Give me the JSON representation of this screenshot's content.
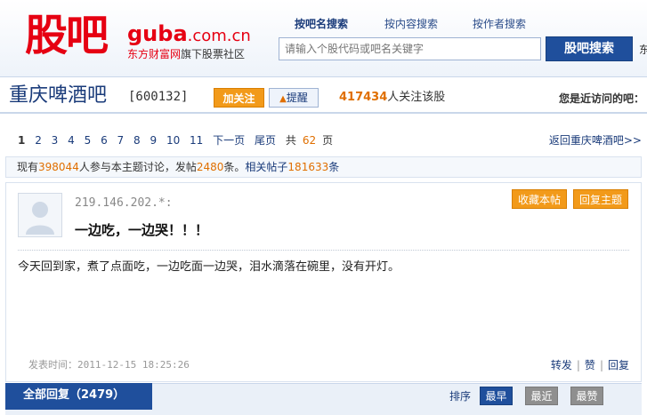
{
  "header": {
    "logo_cn": "股吧",
    "logo_en_main": "guba",
    "logo_en_domain": ".com.cn",
    "logo_sub_brand": "东方财富网",
    "logo_sub_text": "旗下股票社区",
    "tabs": [
      {
        "label": "按吧名搜索",
        "active": true
      },
      {
        "label": "按内容搜索",
        "active": false
      },
      {
        "label": "按作者搜索",
        "active": false
      }
    ],
    "search_placeholder": "请输入个股代码或吧名关键字",
    "search_button": "股吧搜索",
    "edge_text": "东"
  },
  "bar": {
    "name": "重庆啤酒吧",
    "code": "[600132]",
    "follow_button": "加关注",
    "remind_button": "提醒",
    "follower_count": "417434",
    "follower_suffix": "人关注该股",
    "recent_label": "您是近访问的吧："
  },
  "pager": {
    "pages": [
      "1",
      "2",
      "3",
      "4",
      "5",
      "6",
      "7",
      "8",
      "9",
      "10",
      "11"
    ],
    "current": "1",
    "next": "下一页",
    "last": "尾页",
    "total_prefix": "共",
    "total_pages": "62",
    "total_suffix": "页",
    "back_link": "返回重庆啤酒吧>>"
  },
  "stats": {
    "prefix": "现有",
    "participants": "398044",
    "participants_suffix": "人参与本主题讨论，发帖",
    "posts": "2480",
    "posts_suffix": "条。",
    "related_prefix": "相关帖子",
    "related": "181633",
    "related_suffix": "条"
  },
  "post": {
    "author": "219.146.202.*:",
    "title": "一边吃，一边哭！！！",
    "fav_button": "收藏本帖",
    "reply_topic_button": "回复主题",
    "body": "今天回到家，煮了点面吃，一边吃面一边哭，泪水滴落在碗里，没有开灯。",
    "time_label": "发表时间：",
    "time_value": "2011-12-15 18:25:26",
    "actions": [
      "转发",
      "赞",
      "回复"
    ]
  },
  "footer": {
    "all_replies": "全部回复（2479）",
    "sort_label": "排序",
    "sort_buttons": [
      "最早",
      "最近",
      "最赞"
    ]
  },
  "colors": {
    "brand_red": "#e60012",
    "nav_blue": "#1f4f9c",
    "accent_orange": "#f29a1a"
  }
}
